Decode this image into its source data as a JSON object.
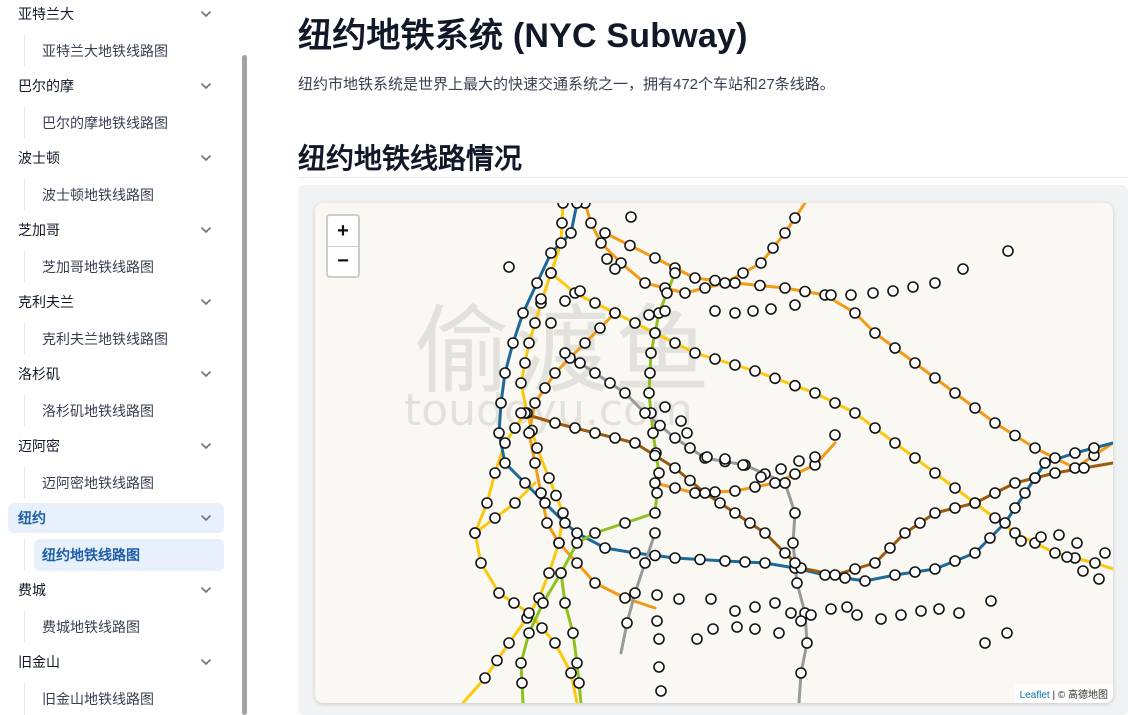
{
  "sidebar": {
    "cities": [
      {
        "name": "亚特兰大",
        "map": "亚特兰大地铁线路图"
      },
      {
        "name": "巴尔的摩",
        "map": "巴尔的摩地铁线路图"
      },
      {
        "name": "波士顿",
        "map": "波士顿地铁线路图"
      },
      {
        "name": "芝加哥",
        "map": "芝加哥地铁线路图"
      },
      {
        "name": "克利夫兰",
        "map": "克利夫兰地铁线路图"
      },
      {
        "name": "洛杉矶",
        "map": "洛杉矶地铁线路图"
      },
      {
        "name": "迈阿密",
        "map": "迈阿密地铁线路图"
      },
      {
        "name": "纽约",
        "map": "纽约地铁线路图",
        "active": true
      },
      {
        "name": "费城",
        "map": "费城地铁线路图"
      },
      {
        "name": "旧金山",
        "map": "旧金山地铁线路图"
      }
    ]
  },
  "page": {
    "title": "纽约地铁系统 (NYC Subway)",
    "intro": "纽约市地铁系统是世界上最大的快速交通系统之一，拥有472个车站和27条线路。",
    "section_title": "纽约地铁线路情况"
  },
  "map": {
    "zoom_in": "+",
    "zoom_out": "−",
    "watermark_main": "偷渡鱼",
    "watermark_sub": "toudoyu.com",
    "attribution_link": "Leaflet",
    "attribution_rest": " | © 高德地图",
    "colors": {
      "yellow": "#fcc80f",
      "orange": "#f39a17",
      "blue": "#1d6a9a",
      "green": "#8ec21f",
      "brown": "#9a5b10",
      "gray": "#9a9a9a",
      "background": "#faf8f2"
    }
  }
}
